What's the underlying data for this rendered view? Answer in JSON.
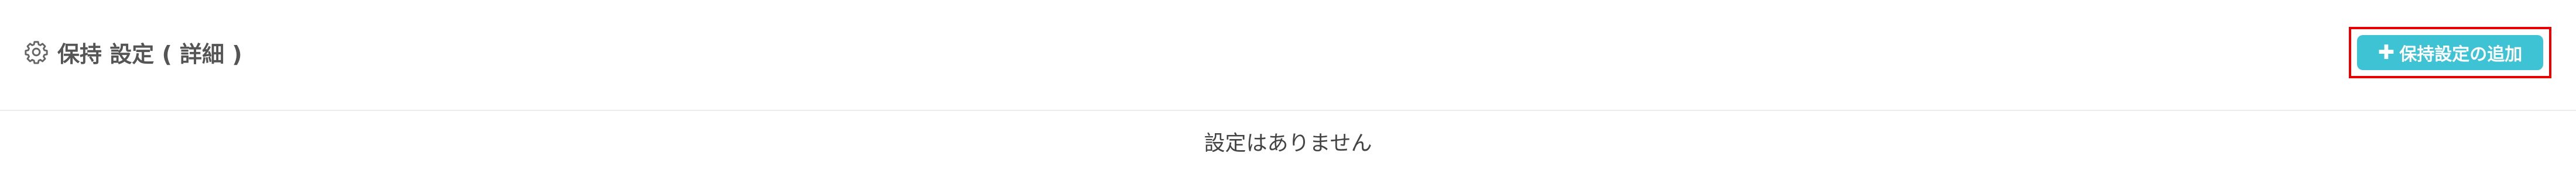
{
  "header": {
    "title": "保持 設定 ( 詳細 )",
    "title_icon": "gear-icon"
  },
  "actions": {
    "add_button_icon": "plus-icon",
    "add_button_label": "保持設定の追加",
    "add_button_color": "#3ec3d5",
    "highlight_color": "#e60000"
  },
  "content": {
    "empty_message": "設定はありません"
  }
}
